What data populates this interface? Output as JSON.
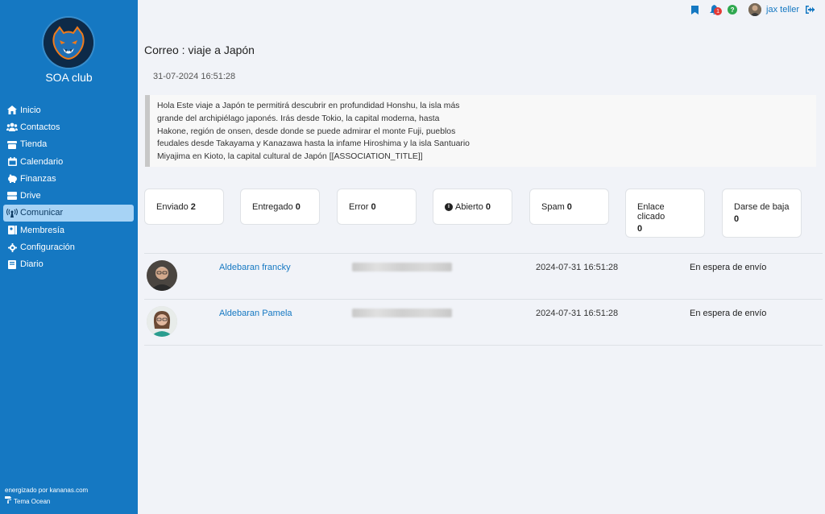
{
  "sidebar": {
    "club_name": "SOA club",
    "items": [
      {
        "label": "Inicio",
        "icon": "home-icon"
      },
      {
        "label": "Contactos",
        "icon": "users-icon"
      },
      {
        "label": "Tienda",
        "icon": "store-icon"
      },
      {
        "label": "Calendario",
        "icon": "calendar-icon"
      },
      {
        "label": "Finanzas",
        "icon": "piggy-bank-icon"
      },
      {
        "label": "Drive",
        "icon": "drive-icon"
      },
      {
        "label": "Comunicar",
        "icon": "broadcast-icon"
      },
      {
        "label": "Membresía",
        "icon": "membership-icon"
      },
      {
        "label": "Configuración",
        "icon": "gear-icon"
      },
      {
        "label": "Diario",
        "icon": "book-icon"
      }
    ],
    "active_index": 6,
    "footer_powered": "energizado por kananas.com",
    "footer_theme": "Tema Ocean"
  },
  "topbar": {
    "notification_count": "1",
    "help_label": "?",
    "user_name": "jax teller"
  },
  "page": {
    "title": "Correo : viaje a Japón",
    "date": "31-07-2024 16:51:28",
    "message": "Hola Este viaje a Japón te permitirá descubrir en profundidad Honshu, la isla más grande del archipiélago japonés. Irás desde Tokio, la capital moderna, hasta Hakone, región de onsen, desde donde se puede admirar el monte Fuji, pueblos feudales desde Takayama y Kanazawa hasta la infame Hiroshima y la isla Santuario Miyajima en Kioto, la capital cultural de Japón [[ASSOCIATION_TITLE]]"
  },
  "stats": [
    {
      "label": "Enviado",
      "value": "2"
    },
    {
      "label": "Entregado",
      "value": "0"
    },
    {
      "label": "Error",
      "value": "0"
    },
    {
      "label": "Abierto",
      "value": "0"
    },
    {
      "label": "Spam",
      "value": "0"
    },
    {
      "label": "Enlace clicado",
      "value": "0"
    },
    {
      "label": "Darse de baja",
      "value": "0"
    }
  ],
  "recipients": [
    {
      "name": "Aldebaran francky",
      "date": "2024-07-31 16:51:28",
      "status": "En espera de envío"
    },
    {
      "name": "Aldebaran Pamela",
      "date": "2024-07-31 16:51:28",
      "status": "En espera de envío"
    }
  ],
  "colors": {
    "sidebar": "#1578c2",
    "active_item": "#a7d3f5",
    "link": "#1578c2",
    "background": "#f1f3f8"
  }
}
